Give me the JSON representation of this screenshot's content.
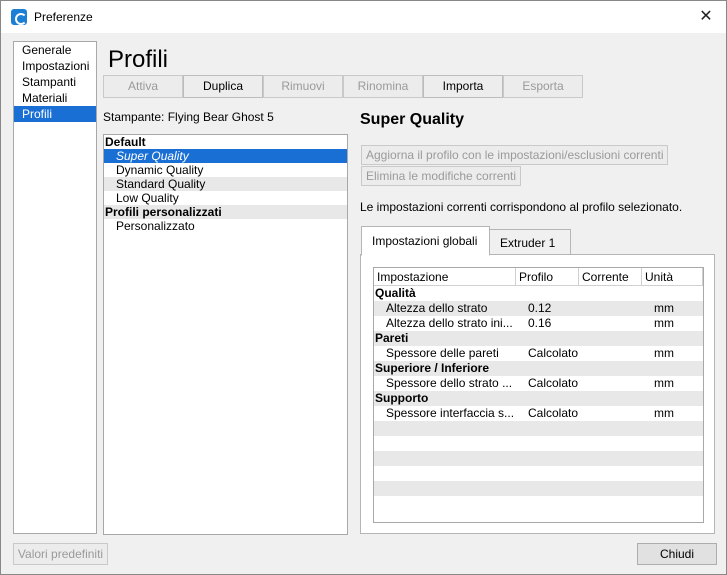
{
  "window": {
    "title": "Preferenze",
    "close_glyph": "✕"
  },
  "nav": {
    "items": [
      "Generale",
      "Impostazioni",
      "Stampanti",
      "Materiali",
      "Profili"
    ],
    "active_index": 4
  },
  "page": {
    "title": "Profili"
  },
  "toolbar": {
    "buttons": [
      {
        "label": "Attiva",
        "enabled": false
      },
      {
        "label": "Duplica",
        "enabled": true
      },
      {
        "label": "Rimuovi",
        "enabled": false
      },
      {
        "label": "Rinomina",
        "enabled": false
      },
      {
        "label": "Importa",
        "enabled": true
      },
      {
        "label": "Esporta",
        "enabled": false
      }
    ]
  },
  "printer": {
    "label": "Stampante: Flying Bear Ghost 5"
  },
  "profiles": [
    {
      "text": "Default",
      "kind": "header"
    },
    {
      "text": "Super Quality",
      "kind": "item",
      "selected": true
    },
    {
      "text": "Dynamic Quality",
      "kind": "item"
    },
    {
      "text": "Standard Quality",
      "kind": "item"
    },
    {
      "text": "Low Quality",
      "kind": "item"
    },
    {
      "text": "Profili personalizzati",
      "kind": "header"
    },
    {
      "text": "Personalizzato",
      "kind": "item"
    }
  ],
  "detail": {
    "profile_name": "Super Quality",
    "update_button": "Aggiorna il profilo con le impostazioni/esclusioni correnti",
    "discard_button": "Elimina le modifiche correnti",
    "status": "Le impostazioni correnti corrispondono al profilo selezionato.",
    "tabs": [
      "Impostazioni globali",
      "Extruder 1"
    ],
    "active_tab": 0
  },
  "table": {
    "columns": [
      "Impostazione",
      "Profilo",
      "Corrente",
      "Unità"
    ],
    "rows": [
      {
        "type": "group",
        "name": "Qualità"
      },
      {
        "type": "setting",
        "name": "Altezza dello strato",
        "profile": "0.12",
        "current": "",
        "unit": "mm"
      },
      {
        "type": "setting",
        "name": "Altezza dello strato ini...",
        "profile": "0.16",
        "current": "",
        "unit": "mm"
      },
      {
        "type": "group",
        "name": "Pareti"
      },
      {
        "type": "setting",
        "name": "Spessore delle pareti",
        "profile": "Calcolato",
        "current": "",
        "unit": "mm"
      },
      {
        "type": "group",
        "name": "Superiore / Inferiore"
      },
      {
        "type": "setting",
        "name": "Spessore dello strato ...",
        "profile": "Calcolato",
        "current": "",
        "unit": "mm"
      },
      {
        "type": "group",
        "name": "Supporto"
      },
      {
        "type": "setting",
        "name": "Spessore interfaccia s...",
        "profile": "Calcolato",
        "current": "",
        "unit": "mm"
      }
    ]
  },
  "footer": {
    "defaults_button": "Valori predefiniti",
    "close_button": "Chiudi"
  }
}
